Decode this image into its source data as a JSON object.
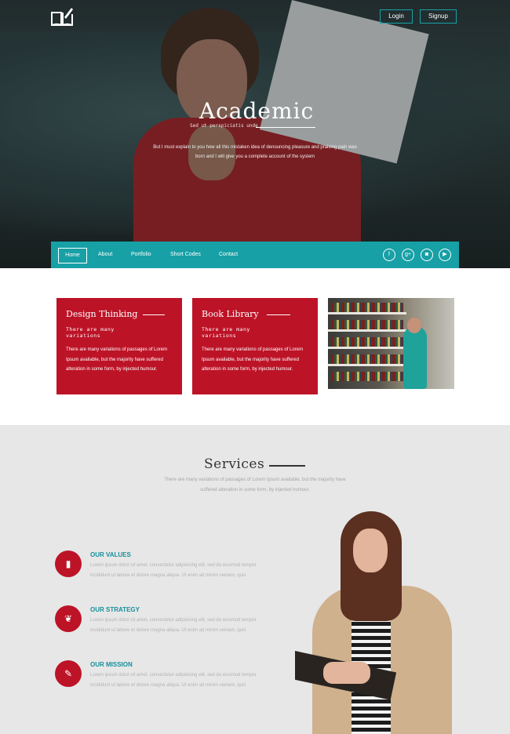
{
  "header": {
    "login_label": "Login",
    "signup_label": "Signup",
    "logo_icon": "book-pencil-icon"
  },
  "hero": {
    "title": "Academic",
    "subtitle": "Sed ut perspiciatis unde",
    "description": "But I must explain to you how all this mistaken idea of denouncing pleasure and praising pain was born and I will give you a complete account of the system"
  },
  "nav": {
    "items": [
      {
        "label": "Home"
      },
      {
        "label": "About"
      },
      {
        "label": "Portfolio"
      },
      {
        "label": "Short Codes"
      },
      {
        "label": "Contact"
      }
    ],
    "social": [
      {
        "icon": "facebook-icon",
        "glyph": "f"
      },
      {
        "icon": "google-plus-icon",
        "glyph": "g+"
      },
      {
        "icon": "instagram-icon",
        "glyph": "◙"
      },
      {
        "icon": "youtube-icon",
        "glyph": "▶"
      }
    ]
  },
  "features": [
    {
      "title": "Design Thinking",
      "subtitle": "There are many variations",
      "body": "There are many variations of passages of Lorem Ipsum available, but the majority have suffered alteration in some form, by injected humour."
    },
    {
      "title": "Book Library",
      "subtitle": "There are many variations",
      "body": "There are many variations of passages of Lorem Ipsum available, but the majority have suffered alteration in some form, by injected humour."
    }
  ],
  "services": {
    "title": "Services",
    "description": "There are many variations of passages of Lorem Ipsum available, but the majority have suffered alteration in some form, by injected humour.",
    "items": [
      {
        "heading": "OUR VALUES",
        "icon": "document-icon",
        "body": "Lorem ipsum dolor sit amet, consectetur adipisicing elit, sed do eiusmod tempor incididunt ut labore et dolore magna aliqua. Ut enim ad minim veniam, quis"
      },
      {
        "heading": "OUR STRATEGY",
        "icon": "leaf-icon",
        "body": "Lorem ipsum dolor sit amet, consectetur adipisicing elit, sed do eiusmod tempor incididunt ut labore et dolore magna aliqua. Ut enim ad minim veniam, quis"
      },
      {
        "heading": "OUR MISSION",
        "icon": "pencil-icon",
        "body": "Lorem ipsum dolor sit amet, consectetur adipisicing elit, sed do eiusmod tempor incididunt ut labore et dolore magna aliqua. Ut enim ad minim veniam, quis"
      }
    ]
  },
  "colors": {
    "accent_teal": "#17a0a6",
    "accent_red": "#bd1327",
    "services_bg": "#e7e7e7"
  }
}
